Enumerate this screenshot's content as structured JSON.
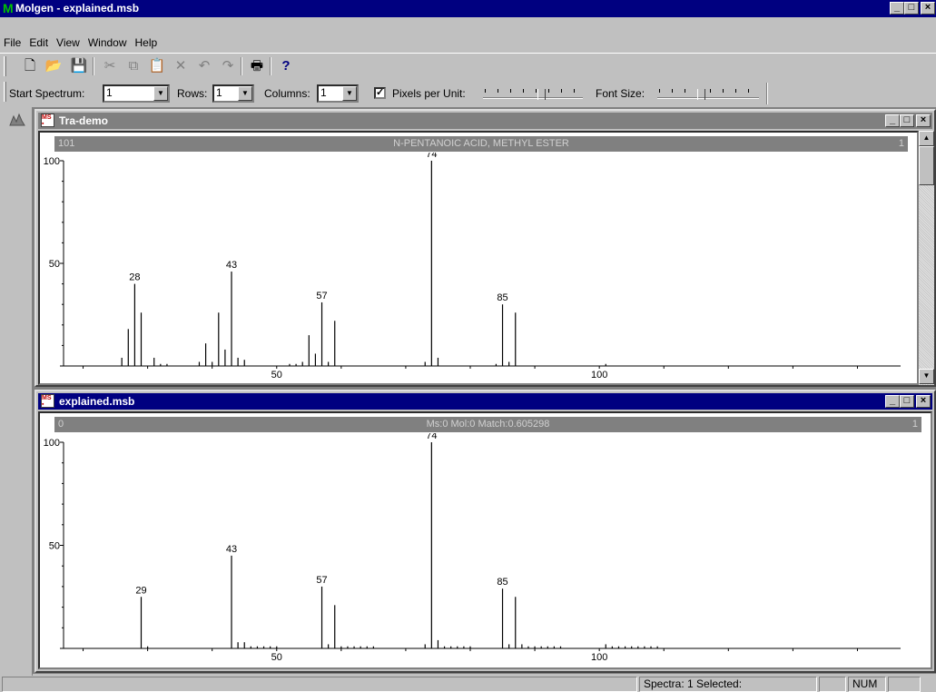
{
  "app": {
    "title": "Molgen - explained.msb",
    "icon_letter": "M"
  },
  "menu": [
    "File",
    "Edit",
    "View",
    "Window",
    "Help"
  ],
  "toolbar": {
    "icons": [
      "new-icon",
      "open-icon",
      "save-icon",
      "cut-icon",
      "copy-icon",
      "paste-icon",
      "delete-icon",
      "undo-icon",
      "redo-icon",
      "print-icon",
      "help-icon"
    ]
  },
  "toolbar2": {
    "start_spectrum_label": "Start Spectrum:",
    "start_spectrum_value": "1",
    "rows_label": "Rows:",
    "rows_value": "1",
    "columns_label": "Columns:",
    "columns_value": "1",
    "pixels_label": "Pixels per Unit:",
    "pixels_checked": true,
    "font_size_label": "Font Size:"
  },
  "windows": [
    {
      "title": "Tra-demo",
      "header": {
        "number": "101",
        "name": "N-PENTANOIC ACID, METHYL ESTER",
        "index": "1"
      }
    },
    {
      "title": "explained.msb",
      "header": {
        "number": "0",
        "name": "Ms:0 Mol:0 Match:0.605298",
        "index": "1"
      }
    }
  ],
  "chart_data": [
    {
      "type": "bar",
      "title": "N-PENTANOIC ACID, METHYL ESTER",
      "xlim": [
        15,
        145
      ],
      "ylim": [
        0,
        100
      ],
      "x_ticks": [
        50,
        100
      ],
      "y_ticks": [
        50,
        100
      ],
      "peaks": [
        {
          "x": 26,
          "y": 4
        },
        {
          "x": 27,
          "y": 18
        },
        {
          "x": 28,
          "y": 40,
          "label": "28"
        },
        {
          "x": 29,
          "y": 26
        },
        {
          "x": 31,
          "y": 4
        },
        {
          "x": 32,
          "y": 1
        },
        {
          "x": 33,
          "y": 1
        },
        {
          "x": 38,
          "y": 2
        },
        {
          "x": 39,
          "y": 11
        },
        {
          "x": 40,
          "y": 2
        },
        {
          "x": 41,
          "y": 26
        },
        {
          "x": 42,
          "y": 8
        },
        {
          "x": 43,
          "y": 46,
          "label": "43"
        },
        {
          "x": 44,
          "y": 4
        },
        {
          "x": 45,
          "y": 3
        },
        {
          "x": 52,
          "y": 1
        },
        {
          "x": 53,
          "y": 1
        },
        {
          "x": 54,
          "y": 2
        },
        {
          "x": 55,
          "y": 15
        },
        {
          "x": 56,
          "y": 6
        },
        {
          "x": 57,
          "y": 31,
          "label": "57"
        },
        {
          "x": 58,
          "y": 2
        },
        {
          "x": 59,
          "y": 22
        },
        {
          "x": 73,
          "y": 2
        },
        {
          "x": 74,
          "y": 100,
          "label": "74"
        },
        {
          "x": 75,
          "y": 4
        },
        {
          "x": 84,
          "y": 1
        },
        {
          "x": 85,
          "y": 30,
          "label": "85"
        },
        {
          "x": 86,
          "y": 2
        },
        {
          "x": 87,
          "y": 26
        },
        {
          "x": 101,
          "y": 1
        }
      ]
    },
    {
      "type": "bar",
      "title": "Ms:0 Mol:0 Match:0.605298",
      "xlim": [
        15,
        145
      ],
      "ylim": [
        0,
        100
      ],
      "x_ticks": [
        50,
        100
      ],
      "y_ticks": [
        50,
        100
      ],
      "peaks": [
        {
          "x": 29,
          "y": 25,
          "label": "29"
        },
        {
          "x": 30,
          "y": 1
        },
        {
          "x": 43,
          "y": 45,
          "label": "43"
        },
        {
          "x": 44,
          "y": 3
        },
        {
          "x": 45,
          "y": 3
        },
        {
          "x": 46,
          "y": 1
        },
        {
          "x": 47,
          "y": 1
        },
        {
          "x": 48,
          "y": 1
        },
        {
          "x": 49,
          "y": 1
        },
        {
          "x": 50,
          "y": 1
        },
        {
          "x": 57,
          "y": 30,
          "label": "57"
        },
        {
          "x": 58,
          "y": 2
        },
        {
          "x": 59,
          "y": 21
        },
        {
          "x": 60,
          "y": 1
        },
        {
          "x": 61,
          "y": 1
        },
        {
          "x": 62,
          "y": 1
        },
        {
          "x": 63,
          "y": 1
        },
        {
          "x": 64,
          "y": 1
        },
        {
          "x": 65,
          "y": 1
        },
        {
          "x": 73,
          "y": 2
        },
        {
          "x": 74,
          "y": 100,
          "label": "74"
        },
        {
          "x": 75,
          "y": 4
        },
        {
          "x": 76,
          "y": 1
        },
        {
          "x": 77,
          "y": 1
        },
        {
          "x": 78,
          "y": 1
        },
        {
          "x": 79,
          "y": 1
        },
        {
          "x": 80,
          "y": 1
        },
        {
          "x": 85,
          "y": 29,
          "label": "85"
        },
        {
          "x": 86,
          "y": 2
        },
        {
          "x": 87,
          "y": 25
        },
        {
          "x": 88,
          "y": 2
        },
        {
          "x": 89,
          "y": 1
        },
        {
          "x": 90,
          "y": 1
        },
        {
          "x": 91,
          "y": 1
        },
        {
          "x": 92,
          "y": 1
        },
        {
          "x": 93,
          "y": 1
        },
        {
          "x": 94,
          "y": 1
        },
        {
          "x": 101,
          "y": 2
        },
        {
          "x": 102,
          "y": 1
        },
        {
          "x": 103,
          "y": 1
        },
        {
          "x": 104,
          "y": 1
        },
        {
          "x": 105,
          "y": 1
        },
        {
          "x": 106,
          "y": 1
        },
        {
          "x": 107,
          "y": 1
        },
        {
          "x": 108,
          "y": 1
        },
        {
          "x": 109,
          "y": 1
        }
      ]
    }
  ],
  "status": {
    "text": "Spectra: 1 Selected:",
    "num": "NUM"
  }
}
